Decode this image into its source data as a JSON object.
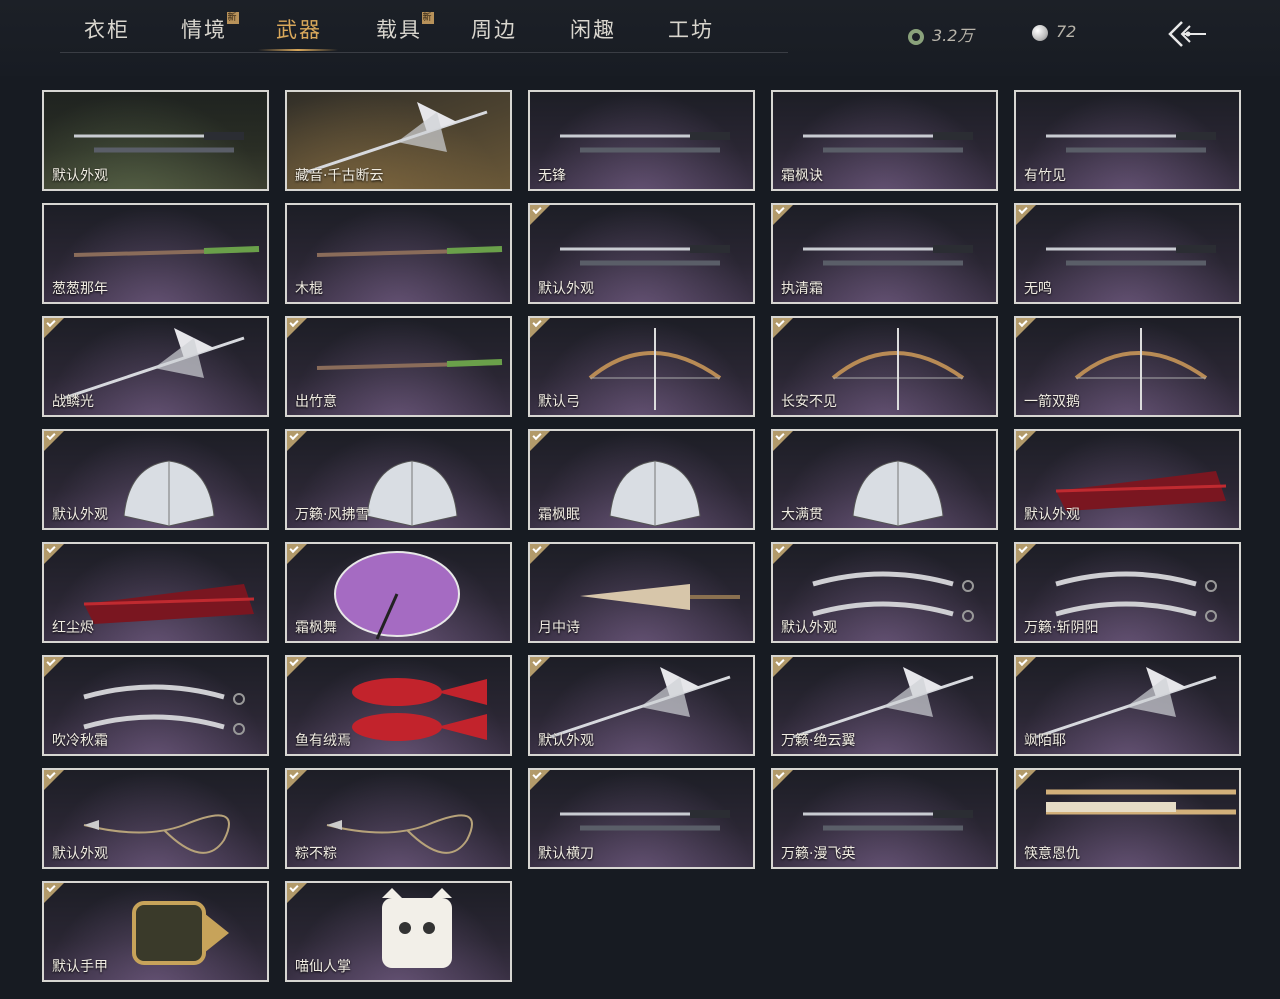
{
  "tabs": [
    {
      "label": "衣柜",
      "badge": ""
    },
    {
      "label": "情境",
      "badge": "新"
    },
    {
      "label": "武器",
      "badge": ""
    },
    {
      "label": "载具",
      "badge": "新"
    },
    {
      "label": "周边",
      "badge": ""
    },
    {
      "label": "闲趣",
      "badge": ""
    },
    {
      "label": "工坊",
      "badge": ""
    }
  ],
  "active_tab": "武器",
  "currency": {
    "jade": "3.2万",
    "pearl": "72"
  },
  "colors": {
    "accent": "#d9a85b",
    "check": "#b29a6a",
    "border": "#d7d6d2"
  },
  "items": [
    {
      "name": "默认外观",
      "icon": "sword-icon",
      "owned": false,
      "style": "green"
    },
    {
      "name": "藏音·千古断云",
      "icon": "spear-icon",
      "owned": false,
      "style": "gold"
    },
    {
      "name": "无锋",
      "icon": "sword-icon",
      "owned": false,
      "style": ""
    },
    {
      "name": "霜枫诀",
      "icon": "sword-icon",
      "owned": false,
      "style": ""
    },
    {
      "name": "有竹见",
      "icon": "sword-icon",
      "owned": false,
      "style": ""
    },
    {
      "name": "葱葱那年",
      "icon": "staff-icon",
      "owned": false,
      "style": ""
    },
    {
      "name": "木棍",
      "icon": "staff-icon",
      "owned": false,
      "style": ""
    },
    {
      "name": "默认外观",
      "icon": "sword-icon",
      "owned": true,
      "style": ""
    },
    {
      "name": "执清霜",
      "icon": "sword-icon",
      "owned": true,
      "style": ""
    },
    {
      "name": "无鸣",
      "icon": "sword-icon",
      "owned": true,
      "style": ""
    },
    {
      "name": "战鳞光",
      "icon": "spear-icon",
      "owned": true,
      "style": ""
    },
    {
      "name": "出竹意",
      "icon": "staff-icon",
      "owned": true,
      "style": ""
    },
    {
      "name": "默认弓",
      "icon": "bow-icon",
      "owned": true,
      "style": ""
    },
    {
      "name": "长安不见",
      "icon": "bow-icon",
      "owned": true,
      "style": ""
    },
    {
      "name": "一箭双鹅",
      "icon": "bow-icon",
      "owned": true,
      "style": ""
    },
    {
      "name": "默认外观",
      "icon": "fan-icon",
      "owned": true,
      "style": ""
    },
    {
      "name": "万籁·风拂雪",
      "icon": "fan-icon",
      "owned": true,
      "style": ""
    },
    {
      "name": "霜枫眠",
      "icon": "fan-icon",
      "owned": true,
      "style": ""
    },
    {
      "name": "大满贯",
      "icon": "fan-icon",
      "owned": true,
      "style": ""
    },
    {
      "name": "默认外观",
      "icon": "closed-fan-icon",
      "owned": true,
      "style": ""
    },
    {
      "name": "红尘烬",
      "icon": "closed-fan-icon",
      "owned": true,
      "style": ""
    },
    {
      "name": "霜枫舞",
      "icon": "umbrella-icon",
      "owned": true,
      "style": ""
    },
    {
      "name": "月中诗",
      "icon": "closed-umbrella-icon",
      "owned": true,
      "style": ""
    },
    {
      "name": "默认外观",
      "icon": "twin-blade-icon",
      "owned": true,
      "style": ""
    },
    {
      "name": "万籁·斩阴阳",
      "icon": "twin-blade-icon",
      "owned": true,
      "style": ""
    },
    {
      "name": "吹冷秋霜",
      "icon": "twin-blade-icon",
      "owned": true,
      "style": ""
    },
    {
      "name": "鱼有绒焉",
      "icon": "fish-icon",
      "owned": true,
      "style": ""
    },
    {
      "name": "默认外观",
      "icon": "spear-icon",
      "owned": true,
      "style": ""
    },
    {
      "name": "万籁·绝云翼",
      "icon": "spear-icon",
      "owned": true,
      "style": ""
    },
    {
      "name": "飒陌耶",
      "icon": "spear-icon",
      "owned": true,
      "style": ""
    },
    {
      "name": "默认外观",
      "icon": "rope-dart-icon",
      "owned": true,
      "style": ""
    },
    {
      "name": "粽不粽",
      "icon": "rope-dart-icon",
      "owned": true,
      "style": ""
    },
    {
      "name": "默认横刀",
      "icon": "sword-icon",
      "owned": true,
      "style": ""
    },
    {
      "name": "万籁·漫飞英",
      "icon": "sword-icon",
      "owned": true,
      "style": ""
    },
    {
      "name": "筷意恩仇",
      "icon": "chopsticks-icon",
      "owned": true,
      "style": ""
    },
    {
      "name": "默认手甲",
      "icon": "gauntlet-icon",
      "owned": true,
      "style": ""
    },
    {
      "name": "喵仙人掌",
      "icon": "cat-paw-icon",
      "owned": true,
      "style": ""
    }
  ]
}
